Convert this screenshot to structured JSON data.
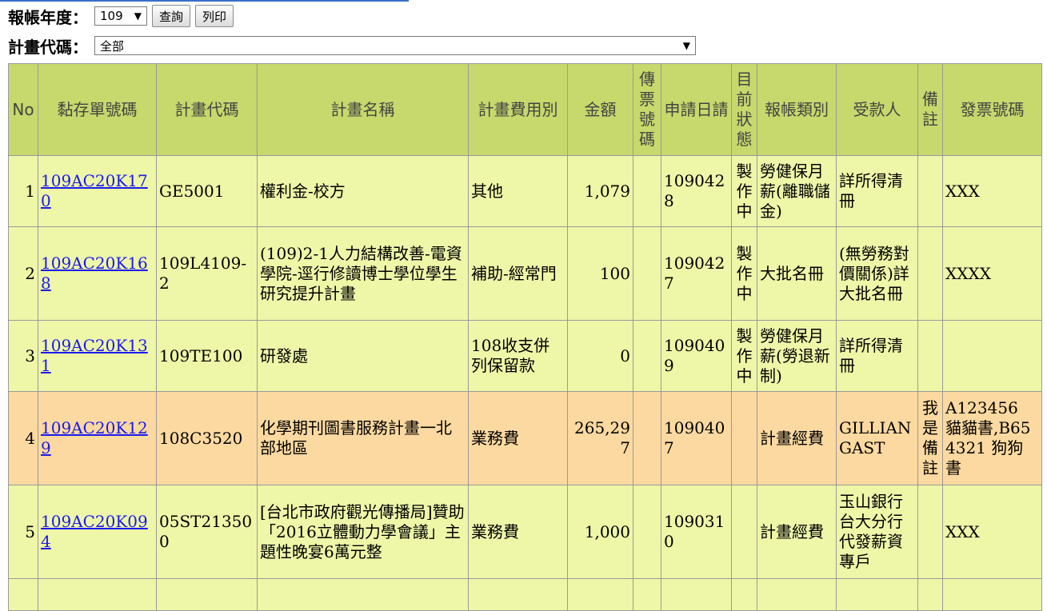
{
  "filter": {
    "year_label": "報帳年度：",
    "year_value": "109",
    "query_button": "查詢",
    "print_button": "列印",
    "plan_label": "計畫代碼：",
    "plan_value": "全部"
  },
  "table": {
    "headers": [
      "No",
      "黏存單號碼",
      "計畫代碼",
      "計畫名稱",
      "計畫費用別",
      "金額",
      "傳票號碼",
      "申請日請",
      "目前狀態",
      "報帳類別",
      "受款人",
      "備註",
      "發票號碼"
    ],
    "rows": [
      {
        "no": "1",
        "voucher": "109AC20K170",
        "code": "GE5001",
        "name": "權利金-校方",
        "fee": "其他",
        "amount": "1,079",
        "ticket": "",
        "date": "1090428",
        "status": "製作中",
        "type": "勞健保月薪(離職儲金)",
        "payee": "詳所得清冊",
        "note": "",
        "invoice": "XXX"
      },
      {
        "no": "2",
        "voucher": "109AC20K168",
        "code": "109L4109-2",
        "name": "(109)2-1人力結構改善-電資學院-逕行修讀博士學位學生研究提升計畫",
        "fee": "補助-經常門",
        "amount": "100",
        "ticket": "",
        "date": "1090427",
        "status": "製作中",
        "type": "大批名冊",
        "payee": "(無勞務對價關係)詳大批名冊",
        "note": "",
        "invoice": "XXXX"
      },
      {
        "no": "3",
        "voucher": "109AC20K131",
        "code": "109TE100",
        "name": "研發處",
        "fee": "108收支併列保留款",
        "amount": "0",
        "ticket": "",
        "date": "1090409",
        "status": "製作中",
        "type": "勞健保月薪(勞退新制)",
        "payee": "詳所得清冊",
        "note": "",
        "invoice": ""
      },
      {
        "no": "4",
        "voucher": "109AC20K129",
        "code": "108C3520",
        "name": "化學期刊圖書服務計畫一北部地區",
        "fee": "業務費",
        "amount": "265,297",
        "ticket": "",
        "date": "1090407",
        "status": "",
        "type": "計畫經費",
        "payee": "GILLIAN GAST",
        "note": "我是備註",
        "invoice": "A123456 貓貓書,B654321 狗狗書"
      },
      {
        "no": "5",
        "voucher": "109AC20K094",
        "code": "05ST213500",
        "name": "[台北市政府觀光傳播局]贊助「2016立體動力學會議」主題性晚宴6萬元整",
        "fee": "業務費",
        "amount": "1,000",
        "ticket": "",
        "date": "1090310",
        "status": "",
        "type": "計畫經費",
        "payee": "玉山銀行台大分行代發薪資專戶",
        "note": "",
        "invoice": "XXX"
      }
    ]
  },
  "colors": {
    "header_bg": "#c7d86c",
    "row_bg": "#eef6a8",
    "row_highlight_bg": "#fcd9a0",
    "link": "#1a1aee"
  }
}
